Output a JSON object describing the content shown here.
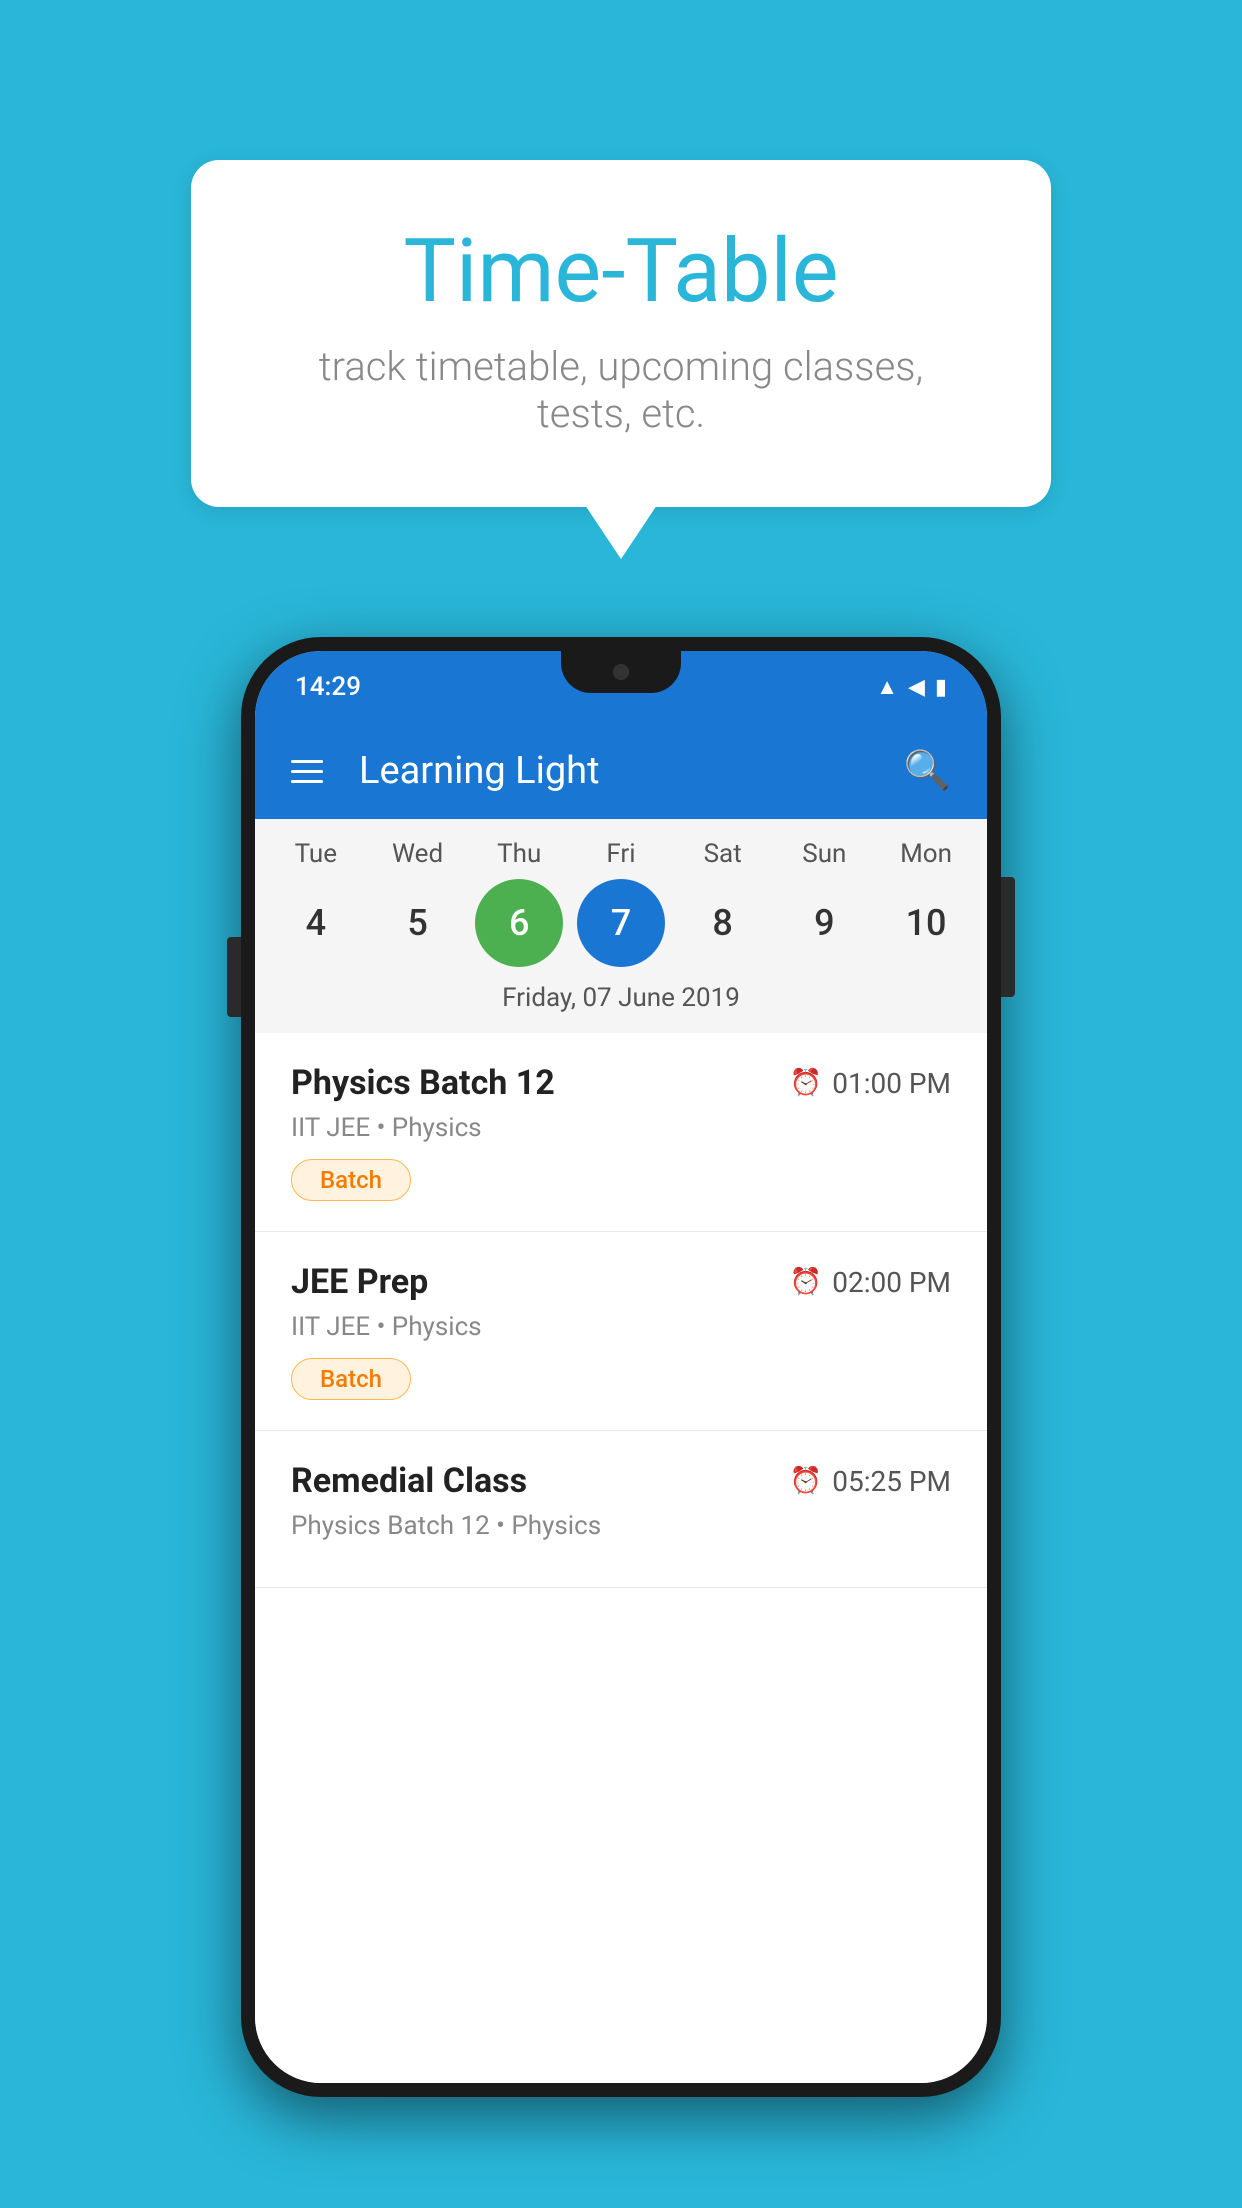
{
  "background_color": "#29B6D8",
  "bubble": {
    "title": "Time-Table",
    "subtitle": "track timetable, upcoming classes, tests, etc."
  },
  "phone": {
    "status_bar": {
      "time": "14:29",
      "icons": [
        "wifi",
        "signal",
        "battery"
      ]
    },
    "app_bar": {
      "title": "Learning Light",
      "menu_icon_label": "menu",
      "search_icon_label": "search"
    },
    "calendar": {
      "days": [
        {
          "name": "Tue",
          "num": "4",
          "state": "normal"
        },
        {
          "name": "Wed",
          "num": "5",
          "state": "normal"
        },
        {
          "name": "Thu",
          "num": "6",
          "state": "today"
        },
        {
          "name": "Fri",
          "num": "7",
          "state": "selected"
        },
        {
          "name": "Sat",
          "num": "8",
          "state": "normal"
        },
        {
          "name": "Sun",
          "num": "9",
          "state": "normal"
        },
        {
          "name": "Mon",
          "num": "10",
          "state": "normal"
        }
      ],
      "selected_date_label": "Friday, 07 June 2019"
    },
    "schedule_items": [
      {
        "title": "Physics Batch 12",
        "time": "01:00 PM",
        "subtitle": "IIT JEE • Physics",
        "badge": "Batch"
      },
      {
        "title": "JEE Prep",
        "time": "02:00 PM",
        "subtitle": "IIT JEE • Physics",
        "badge": "Batch"
      },
      {
        "title": "Remedial Class",
        "time": "05:25 PM",
        "subtitle": "Physics Batch 12 • Physics",
        "badge": null
      }
    ]
  }
}
